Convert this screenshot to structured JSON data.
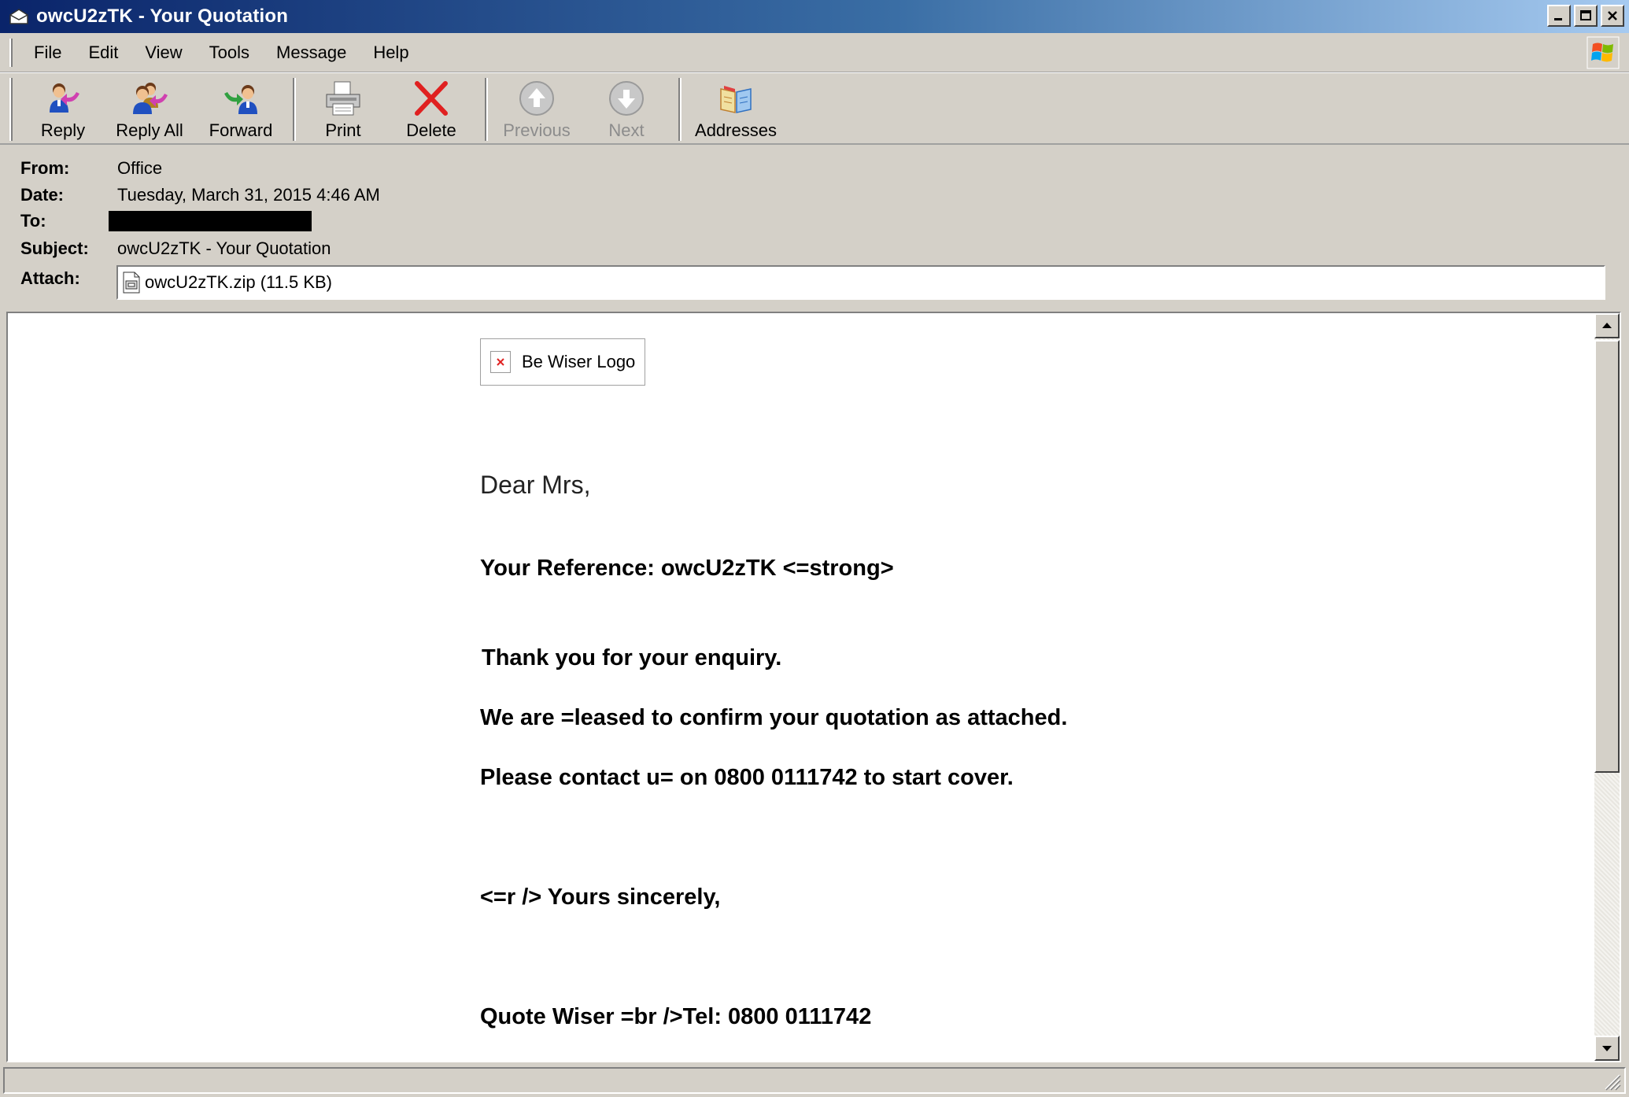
{
  "window": {
    "title": "owcU2zTK - Your Quotation"
  },
  "menu": {
    "items": [
      "File",
      "Edit",
      "View",
      "Tools",
      "Message",
      "Help"
    ]
  },
  "toolbar": {
    "reply": "Reply",
    "reply_all": "Reply All",
    "forward": "Forward",
    "print": "Print",
    "delete": "Delete",
    "previous": "Previous",
    "next": "Next",
    "addresses": "Addresses"
  },
  "headers": {
    "from_label": "From:",
    "from_value": "Office",
    "date_label": "Date:",
    "date_value": "Tuesday, March 31, 2015 4:46 AM",
    "to_label": "To:",
    "subject_label": "Subject:",
    "subject_value": "owcU2zTK - Your Quotation",
    "attach_label": "Attach:",
    "attach_value": "owcU2zTK.zip (11.5 KB)"
  },
  "message": {
    "logo_alt": "Be Wiser Logo",
    "greeting": "Dear Mrs,",
    "reference": "Your Reference: owcU2zTK <=strong>",
    "thanks": "Thank you for your enquiry.",
    "confirm": "We are =leased to confirm your quotation as attached.",
    "contact": "Please contact u= on 0800 0111742 to start cover.",
    "sincerely": "<=r /> Yours sincerely,",
    "signature": "Quote Wiser =br />Tel: 0800 0111742"
  },
  "colors": {
    "titlebar_start": "#0a246a",
    "titlebar_end": "#a6caf0",
    "chrome": "#d4d0c8",
    "delete_red": "#e02020"
  }
}
